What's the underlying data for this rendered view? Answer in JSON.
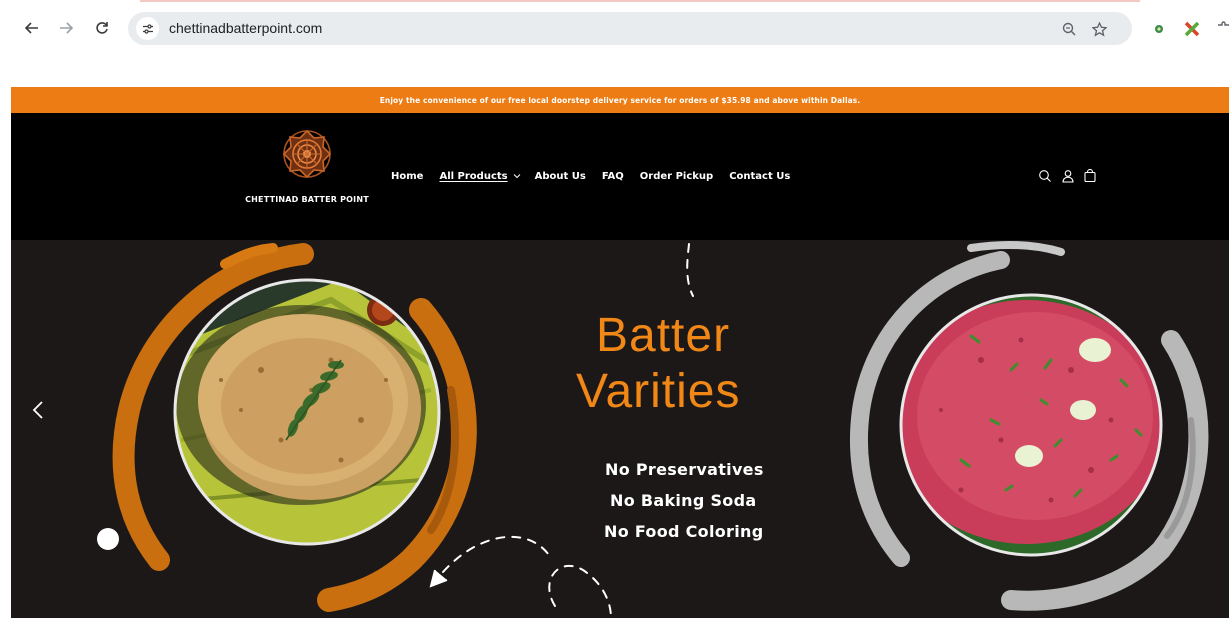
{
  "browser": {
    "url": "chettinadbatterpoint.com",
    "icons": [
      "back-arrow-icon",
      "forward-arrow-icon",
      "reload-icon",
      "site-settings-icon",
      "zoom-icon",
      "bookmark-star-icon",
      "extension-icon"
    ]
  },
  "announcement": {
    "text": "Enjoy the convenience of our free local doorstep delivery service for orders of $35.98 and above within Dallas."
  },
  "header": {
    "logo_text": "CHETTINAD BATTER POINT",
    "nav": [
      {
        "label": "Home"
      },
      {
        "label": "All Products"
      },
      {
        "label": "About Us"
      },
      {
        "label": "FAQ"
      },
      {
        "label": "Order Pickup"
      },
      {
        "label": "Contact Us"
      }
    ],
    "icons": [
      "search-icon",
      "account-icon",
      "cart-icon"
    ]
  },
  "hero": {
    "title_line1": "Batter",
    "title_line2": "Varities",
    "claims": [
      "No Preservatives",
      "No Baking Soda",
      "No Food Coloring"
    ]
  },
  "colors": {
    "accent_orange": "#ec7c13",
    "title_orange": "#f08716",
    "header_bg": "#000000",
    "hero_bg": "#1b1817"
  }
}
